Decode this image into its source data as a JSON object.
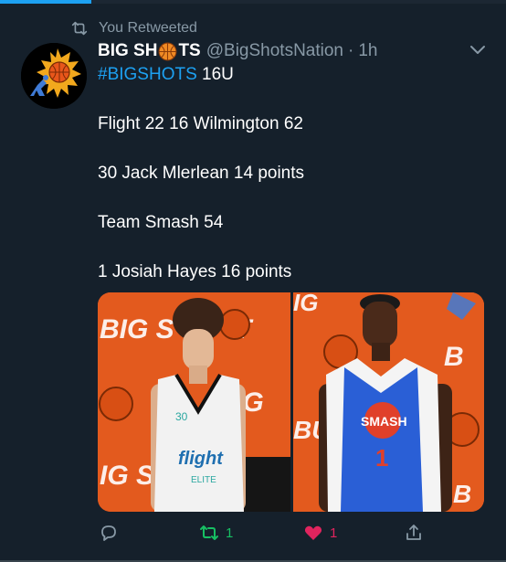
{
  "progress": {
    "fraction": 0.18,
    "color": "#1da1f2"
  },
  "retweet_context": {
    "icon": "retweet-icon",
    "text": "You Retweeted"
  },
  "tweet": {
    "author": {
      "name_part1": "BIG SH",
      "name_part2": "TS",
      "name_emoji": "basketball-icon",
      "handle": "@BigShotsNation",
      "separator": "·",
      "time": "1h"
    },
    "menu_icon": "chevron-down-icon",
    "hashtag": "#BIGSHOTS",
    "line1_rest": " 16U",
    "lines": [
      "Flight 22 16 Wilmington 62",
      "30 Jack Mlerlean 14 points",
      "Team Smash 54",
      "1 Josiah Hayes 16 points"
    ],
    "media": {
      "left_jersey": {
        "brand": "flight",
        "sub": "ELITE",
        "number": "30"
      },
      "right_jersey": {
        "brand": "SMASH",
        "number": "1"
      }
    },
    "actions": {
      "reply": {
        "icon": "reply-icon",
        "count": ""
      },
      "retweet": {
        "icon": "retweet-icon",
        "count": "1",
        "color": "#17bf63"
      },
      "like": {
        "icon": "heart-icon",
        "count": "1",
        "color": "#e0245e"
      },
      "share": {
        "icon": "share-icon"
      }
    }
  },
  "colors": {
    "background": "#15202b",
    "muted": "#8899a6",
    "link": "#1da1f2"
  }
}
